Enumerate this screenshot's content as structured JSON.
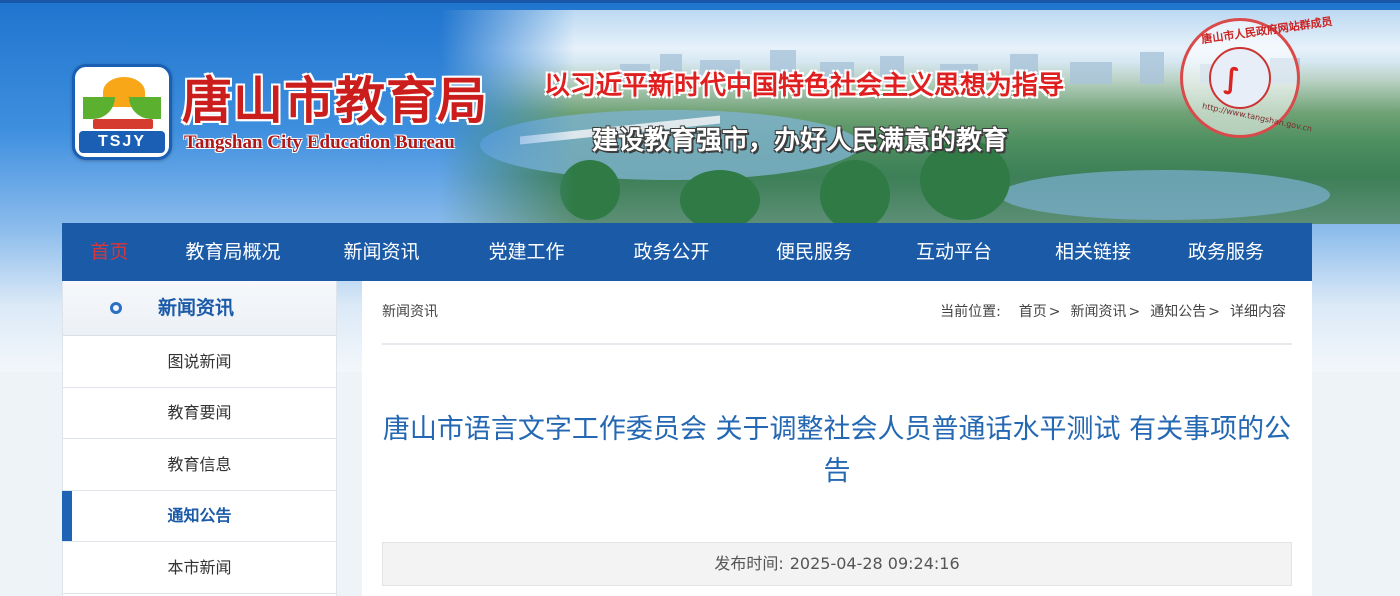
{
  "header": {
    "logo_text": "TSJY",
    "site_title": "唐山市教育局",
    "site_title_en": "Tangshan City Education Bureau",
    "slogan_1": "以习近平新时代中国特色社会主义思想为指导",
    "slogan_2": "建设教育强市，办好人民满意的教育",
    "badge_ring_text": "唐山市人民政府网站群成员",
    "badge_url": "http://www.tangshan.gov.cn"
  },
  "nav": {
    "items": [
      {
        "label": "首页",
        "active": true
      },
      {
        "label": "教育局概况"
      },
      {
        "label": "新闻资讯"
      },
      {
        "label": "党建工作"
      },
      {
        "label": "政务公开"
      },
      {
        "label": "便民服务"
      },
      {
        "label": "互动平台"
      },
      {
        "label": "相关链接"
      },
      {
        "label": "政务服务"
      }
    ]
  },
  "sidebar": {
    "title": "新闻资讯",
    "items": [
      {
        "label": "图说新闻"
      },
      {
        "label": "教育要闻"
      },
      {
        "label": "教育信息"
      },
      {
        "label": "通知公告",
        "active": true
      },
      {
        "label": "本市新闻"
      }
    ]
  },
  "main": {
    "section_label": "新闻资讯",
    "breadcrumb": {
      "prefix": "当前位置:",
      "items": [
        "首页",
        "新闻资讯",
        "通知公告",
        "详细内容"
      ]
    },
    "article_title": "唐山市语言文字工作委员会 关于调整社会人员普通话水平测试 有关事项的公告",
    "publish_label": "发布时间:",
    "publish_time": "2025-04-28 09:24:16"
  },
  "colors": {
    "nav_bg": "#1a5aa6",
    "nav_active": "#d8363a",
    "title_blue": "#2467b3",
    "brand_red": "#cc1d1d"
  }
}
